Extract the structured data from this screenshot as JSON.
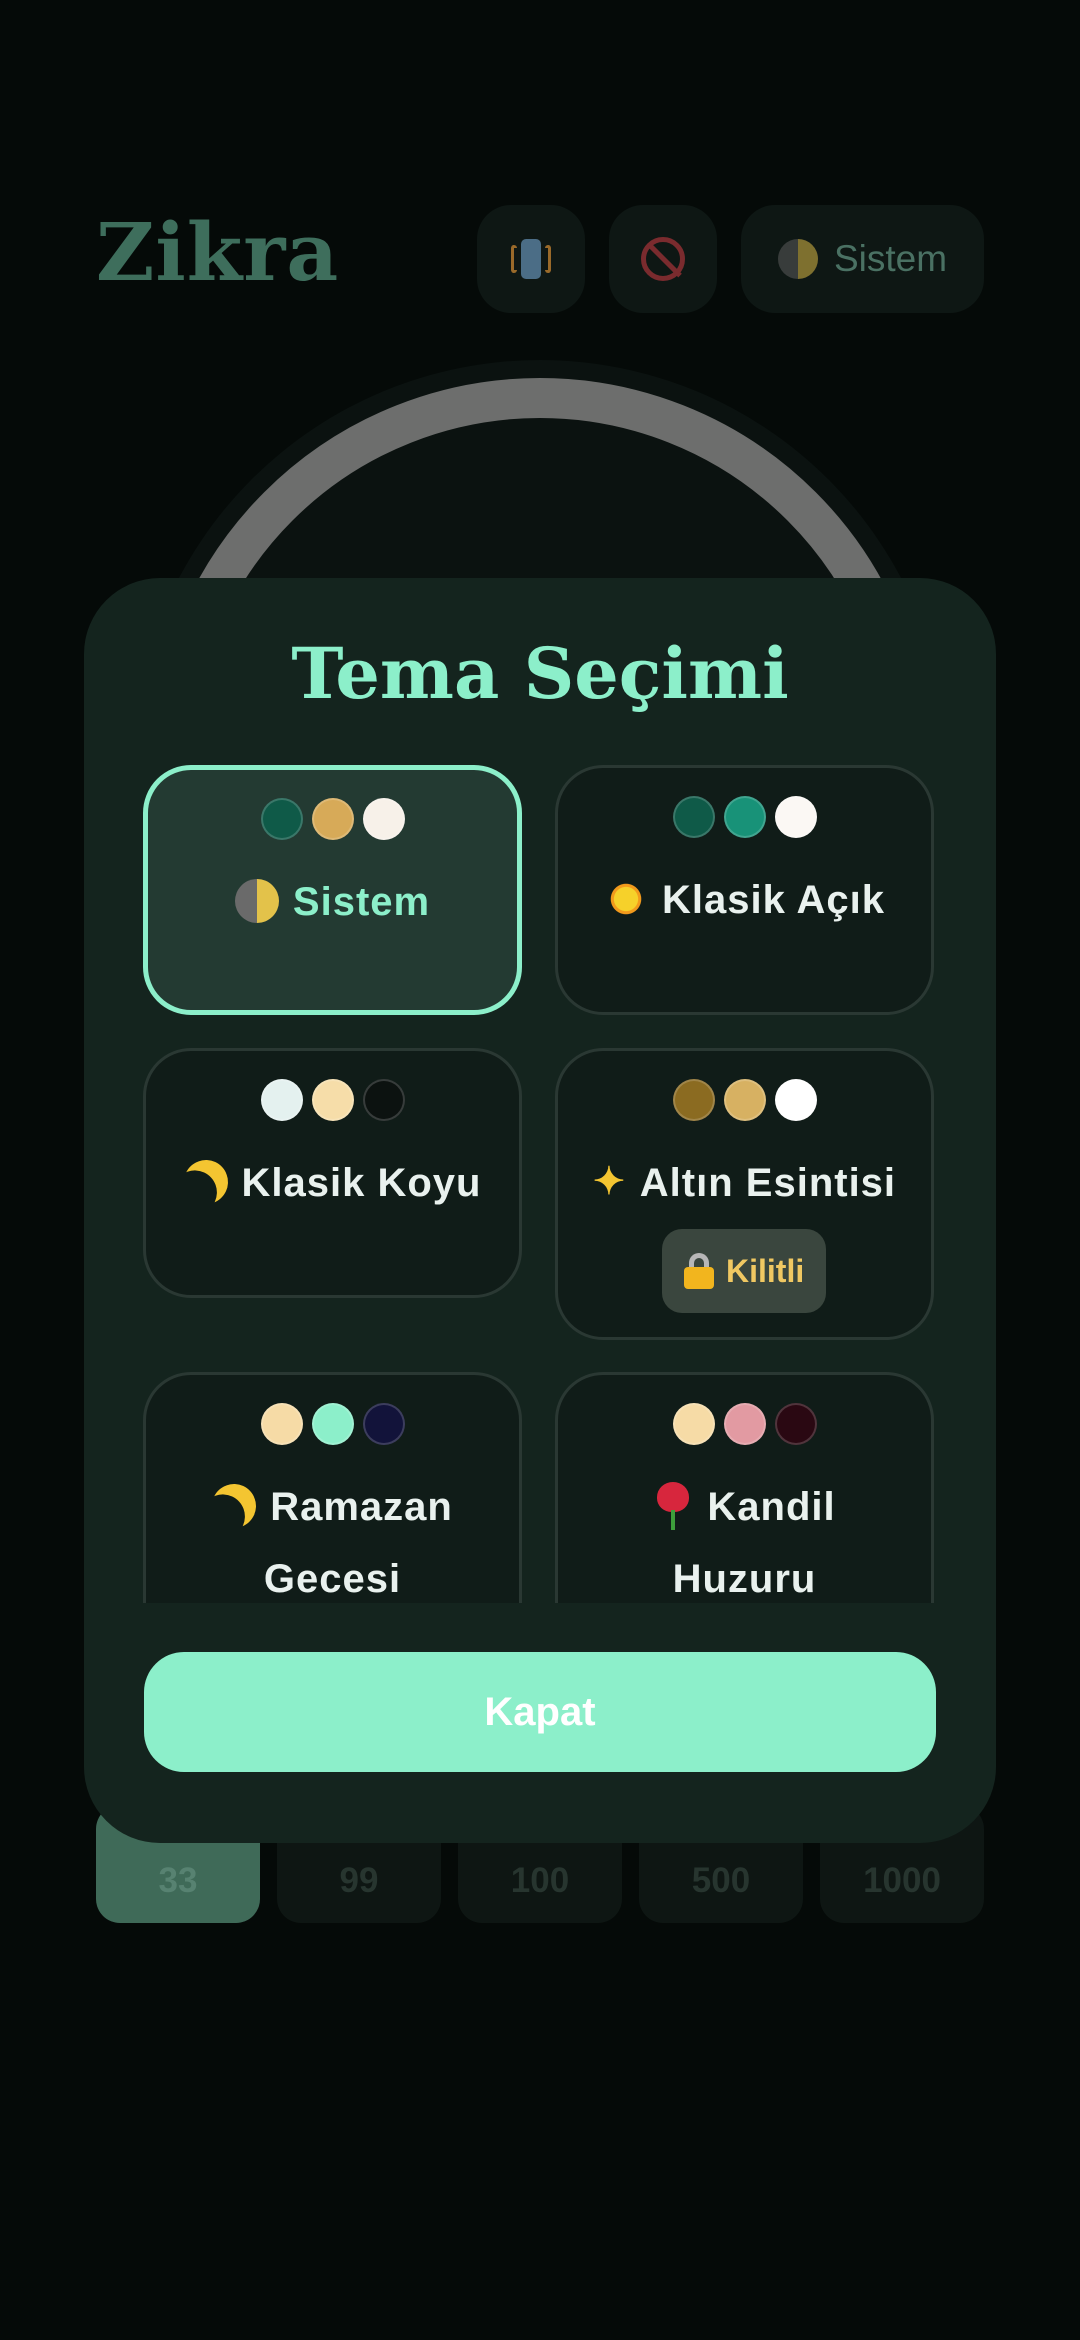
{
  "app": {
    "title": "Zikra",
    "theme_button_label": "Sistem"
  },
  "counts": [
    "33",
    "99",
    "100",
    "500",
    "1000"
  ],
  "modal": {
    "title": "Tema Seçimi",
    "close_label": "Kapat",
    "themes": [
      {
        "label": "Sistem",
        "icon": "half-moon-icon",
        "swatches": [
          "#0f5a48",
          "#d7aa58",
          "#f7f1e9"
        ],
        "selected": true
      },
      {
        "label": "Klasik Açık",
        "icon": "sun-icon",
        "swatches": [
          "#0f5a48",
          "#189278",
          "#fbf8f4"
        ],
        "selected": false
      },
      {
        "label": "Klasik Koyu",
        "icon": "crescent-moon-icon",
        "swatches": [
          "#e4f1ef",
          "#f6dda9",
          "#0c1210"
        ],
        "selected": false
      },
      {
        "label": "Altın Esintisi",
        "icon": "sparkles-icon",
        "swatches": [
          "#8b6b21",
          "#d7b162",
          "#ffffff"
        ],
        "selected": false,
        "locked": true,
        "lock_label": "Kilitli"
      },
      {
        "label": "Ramazan Gecesi",
        "icon": "crescent-moon-icon",
        "swatches": [
          "#f6dba6",
          "#8cefca",
          "#12133a"
        ],
        "selected": false
      },
      {
        "label": "Kandil Huzuru",
        "icon": "rose-icon",
        "swatches": [
          "#f6dba6",
          "#e29aa2",
          "#2a0812"
        ],
        "selected": false
      }
    ]
  },
  "colors": {
    "accent": "#8cefca",
    "modal_bg": "#14241e",
    "card_bg": "#101c18",
    "lock": "#f0c862"
  }
}
